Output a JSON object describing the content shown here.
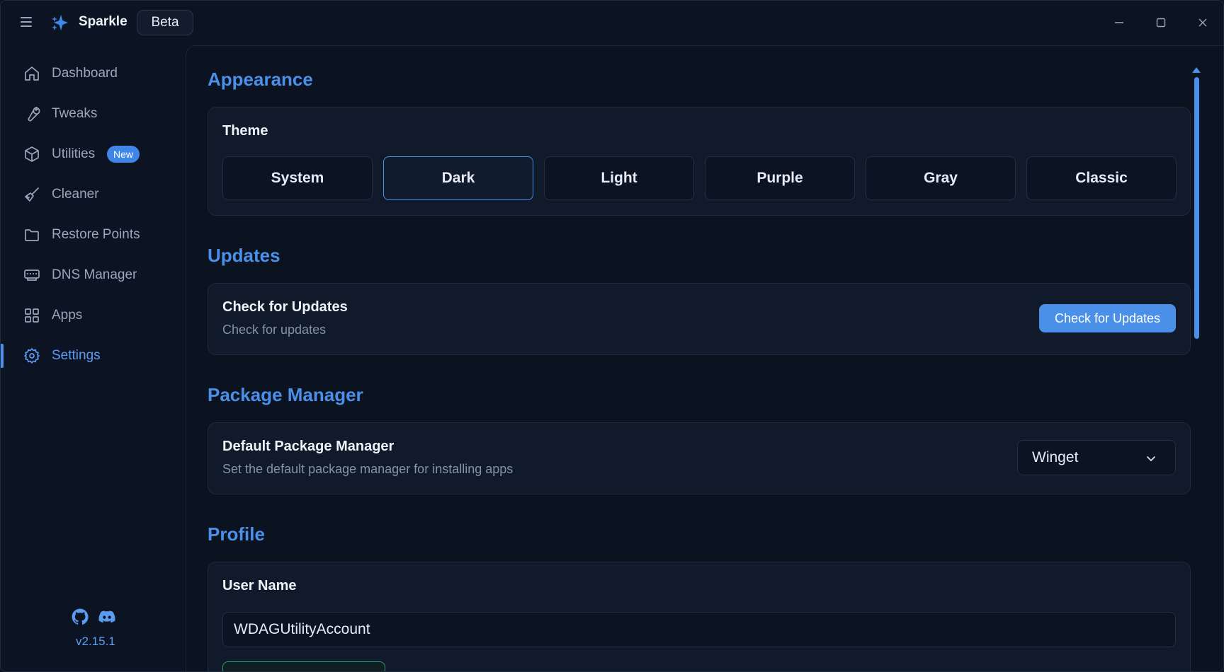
{
  "app": {
    "name": "Sparkle",
    "badge": "Beta",
    "version": "v2.15.1"
  },
  "sidebar": {
    "items": [
      {
        "label": "Dashboard",
        "icon": "home-icon"
      },
      {
        "label": "Tweaks",
        "icon": "wrench-icon"
      },
      {
        "label": "Utilities",
        "icon": "box-icon",
        "badge": "New"
      },
      {
        "label": "Cleaner",
        "icon": "broom-icon"
      },
      {
        "label": "Restore Points",
        "icon": "folder-icon"
      },
      {
        "label": "DNS Manager",
        "icon": "network-icon"
      },
      {
        "label": "Apps",
        "icon": "grid-icon"
      },
      {
        "label": "Settings",
        "icon": "gear-icon",
        "active": true
      }
    ],
    "social": [
      "github-icon",
      "discord-icon"
    ]
  },
  "appearance": {
    "title": "Appearance",
    "theme_label": "Theme",
    "themes": [
      "System",
      "Dark",
      "Light",
      "Purple",
      "Gray",
      "Classic"
    ],
    "selected": "Dark"
  },
  "updates": {
    "title": "Updates",
    "item_title": "Check for Updates",
    "item_desc": "Check for updates",
    "button": "Check for Updates"
  },
  "package_manager": {
    "title": "Package Manager",
    "item_title": "Default Package Manager",
    "item_desc": "Set the default package manager for installing apps",
    "selected": "Winget"
  },
  "profile": {
    "title": "Profile",
    "user_label": "User Name",
    "user_value": "WDAGUtilityAccount"
  },
  "colors": {
    "accent": "#4a8fe8",
    "background": "#0b1220",
    "card": "#111a2a"
  }
}
